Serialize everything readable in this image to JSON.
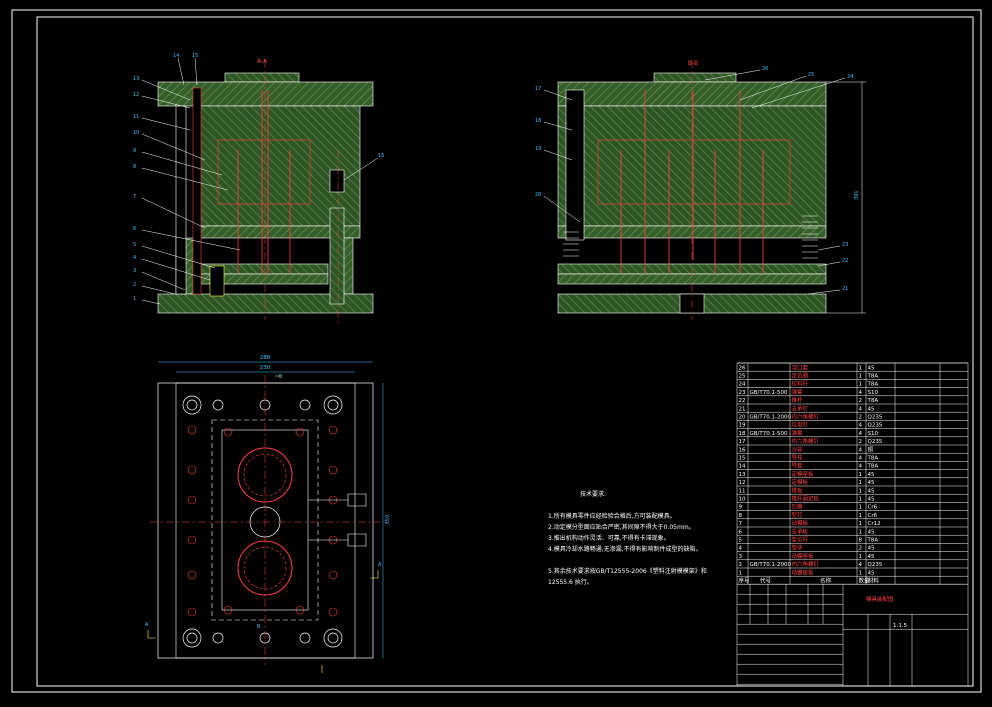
{
  "drawing": {
    "section_aa": "A-A",
    "section_bb": "B-B",
    "dim_width_outer": "288",
    "dim_width_inner": "230",
    "dim_height_plan": "350",
    "dim_height_side": "391",
    "section_marks": [
      "B",
      "B",
      "A",
      "A"
    ],
    "view_aa_callouts": [
      "13",
      "12",
      "11",
      "10",
      "9",
      "8",
      "7",
      "6",
      "5",
      "4",
      "3",
      "2",
      "1",
      "14",
      "15",
      "16"
    ],
    "view_bb_callouts": [
      "17",
      "18",
      "19",
      "20",
      "26",
      "25",
      "24",
      "23",
      "22",
      "21"
    ]
  },
  "requirements": {
    "title": "技术要求:",
    "lines": [
      "1.所有模具零件应经检验合格后,方可装配模具。",
      "2.动定模分型面应贴合严密,其间隙不得大于0.05mm。",
      "3.推出机构动作灵活、可靠,不得有卡滞现象。",
      "4.模具冷却水路畅通,无渗漏,不得有影响制件成型的缺陷。",
      "5.其余技术要求按GB/T12555-2006《塑料注射模模架》和",
      "12555.6 执行。"
    ]
  },
  "bom": {
    "rows": [
      [
        "26",
        "浇口套",
        "1",
        "45",
        ""
      ],
      [
        "25",
        "定位圈",
        "1",
        "T8A",
        ""
      ],
      [
        "24",
        "拉料杆",
        "1",
        "T8A",
        ""
      ],
      [
        "23",
        "GB/T70.1-500",
        "弹簧",
        "4",
        "S10"
      ],
      [
        "22",
        "",
        "推杆",
        "2",
        "T8A"
      ],
      [
        "21",
        "",
        "支承钉",
        "4",
        "45"
      ],
      [
        "20",
        "GB/T70.1-2000",
        "内六角螺钉",
        "2",
        "Q235"
      ],
      [
        "19",
        "",
        "垃圾钉",
        "4",
        "Q235"
      ],
      [
        "18",
        "GB/T70.1-500",
        "弹簧",
        "4",
        "S10"
      ],
      [
        "17",
        "",
        "内六角螺钉",
        "2",
        "Q235"
      ],
      [
        "16",
        "",
        "冷却",
        "4",
        "铜"
      ],
      [
        "15",
        "",
        "导柱",
        "4",
        "T8A"
      ],
      [
        "14",
        "",
        "导套",
        "4",
        "T8A"
      ],
      [
        "13",
        "",
        "定模座板",
        "1",
        "45"
      ],
      [
        "12",
        "",
        "定模板",
        "1",
        "45"
      ],
      [
        "11",
        "",
        "推板",
        "1",
        "45"
      ],
      [
        "10",
        "",
        "推杆固定板",
        "1",
        "45"
      ],
      [
        "9",
        "",
        "凹模",
        "1",
        "Cr6"
      ],
      [
        "8",
        "",
        "型芯",
        "1",
        "Cr6"
      ],
      [
        "7",
        "",
        "动模板",
        "1",
        "Cr12"
      ],
      [
        "6",
        "",
        "支承板",
        "1",
        "45"
      ],
      [
        "5",
        "",
        "复位杆",
        "8",
        "T8A"
      ],
      [
        "4",
        "",
        "垫块",
        "2",
        "45"
      ],
      [
        "3",
        "",
        "动模座板",
        "1",
        "45"
      ],
      [
        "2",
        "GB/T70.1-2000",
        "内六角螺钉",
        "4",
        "Q235"
      ],
      [
        "1",
        "",
        "动模座板",
        "1",
        "45"
      ]
    ],
    "header": [
      "序号",
      "代号",
      "名称",
      "数量",
      "材料"
    ],
    "title": "模具装配图",
    "scale": "1:1.5"
  },
  "colors": {
    "bg": "#000000",
    "hatch": "#4c8a3c",
    "outline": "#ffffff",
    "pink": "#ff4040",
    "cyan": "#40c0ff",
    "yellow": "#ffff40"
  }
}
